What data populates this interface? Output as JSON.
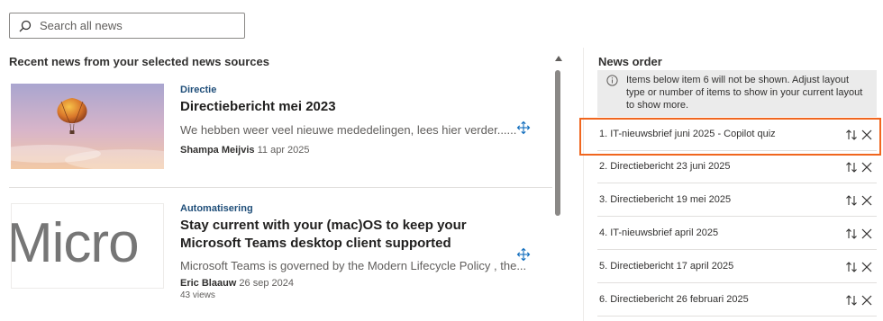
{
  "search": {
    "placeholder": "Search all news"
  },
  "feed": {
    "section_title": "Recent news from your selected news sources",
    "items": [
      {
        "category": "Directie",
        "title": "Directiebericht mei 2023",
        "description": "We hebben weer veel nieuwe mededelingen, lees hier verder......",
        "author": "Shampa Meijvis",
        "date": "11 apr 2025",
        "thumbnail": "hot-air-balloon-image"
      },
      {
        "category": "Automatisering",
        "title": "Stay current with your (mac)OS to keep your Microsoft Teams desktop client supported",
        "description": "Microsoft Teams is governed by the Modern Lifecycle Policy , the...",
        "author": "Eric Blaauw",
        "date": "26 sep 2024",
        "views": "43 views",
        "thumbnail_text": "Micro"
      }
    ]
  },
  "news_order": {
    "title": "News order",
    "info": "Items below item 6 will not be shown. Adjust layout type or number of items to show in your current layout to show more.",
    "items": [
      {
        "label": "1.  IT-nieuwsbrief juni 2025 - Copilot quiz"
      },
      {
        "label": "2.  Directiebericht 23 juni 2025"
      },
      {
        "label": "3.  Directiebericht 19 mei 2025"
      },
      {
        "label": "4.  IT-nieuwsbrief april 2025"
      },
      {
        "label": "5.  Directiebericht 17 april 2025"
      },
      {
        "label": "6.  Directiebericht 26 februari 2025"
      }
    ],
    "highlight_color": "#f0661e"
  },
  "icons": [
    "search-icon",
    "move-icon",
    "info-icon",
    "reorder-icon",
    "close-icon"
  ]
}
